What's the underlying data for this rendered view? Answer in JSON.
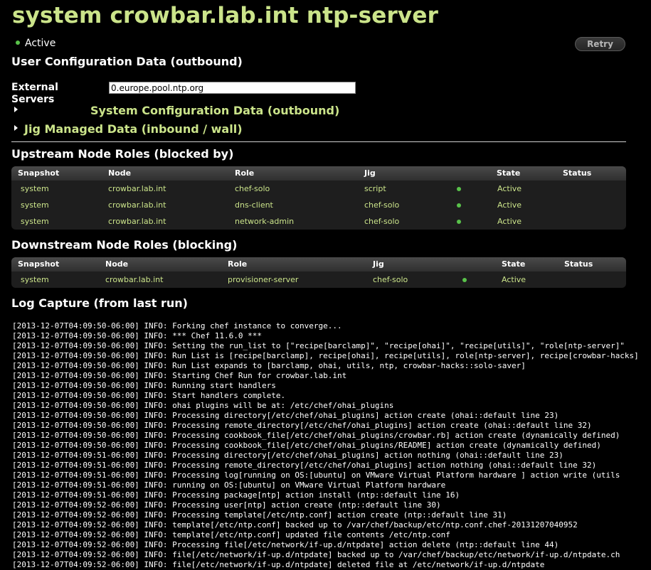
{
  "page": {
    "title": "system crowbar.lab.int ntp-server",
    "status": "Active",
    "retry_label": "Retry"
  },
  "user_config": {
    "heading": "User Configuration Data (outbound)",
    "external_servers_label": "External Servers",
    "external_servers_value": "0.europe.pool.ntp.org"
  },
  "system_config": {
    "heading": "System Configuration Data (outbound)"
  },
  "jig_data": {
    "heading": "Jig Managed Data (inbound / wall)"
  },
  "upstream": {
    "heading": "Upstream Node Roles (blocked by)",
    "columns": [
      "Snapshot",
      "Node",
      "Role",
      "Jig",
      "State",
      "Status"
    ],
    "rows": [
      {
        "snapshot": "system",
        "node": "crowbar.lab.int",
        "role": "chef-solo",
        "jig": "script",
        "state": "Active",
        "status": ""
      },
      {
        "snapshot": "system",
        "node": "crowbar.lab.int",
        "role": "dns-client",
        "jig": "chef-solo",
        "state": "Active",
        "status": ""
      },
      {
        "snapshot": "system",
        "node": "crowbar.lab.int",
        "role": "network-admin",
        "jig": "chef-solo",
        "state": "Active",
        "status": ""
      }
    ]
  },
  "downstream": {
    "heading": "Downstream Node Roles (blocking)",
    "columns": [
      "Snapshot",
      "Node",
      "Role",
      "Jig",
      "State",
      "Status"
    ],
    "rows": [
      {
        "snapshot": "system",
        "node": "crowbar.lab.int",
        "role": "provisioner-server",
        "jig": "chef-solo",
        "state": "Active",
        "status": ""
      }
    ]
  },
  "log": {
    "heading": "Log Capture (from last run)",
    "lines": [
      "[2013-12-07T04:09:50-06:00] INFO: Forking chef instance to converge...",
      "[2013-12-07T04:09:50-06:00] INFO: *** Chef 11.6.0 ***",
      "[2013-12-07T04:09:50-06:00] INFO: Setting the run_list to [\"recipe[barclamp]\", \"recipe[ohai]\", \"recipe[utils]\", \"role[ntp-server]\"",
      "[2013-12-07T04:09:50-06:00] INFO: Run List is [recipe[barclamp], recipe[ohai], recipe[utils], role[ntp-server], recipe[crowbar-hacks]",
      "[2013-12-07T04:09:50-06:00] INFO: Run List expands to [barclamp, ohai, utils, ntp, crowbar-hacks::solo-saver]",
      "[2013-12-07T04:09:50-06:00] INFO: Starting Chef Run for crowbar.lab.int",
      "[2013-12-07T04:09:50-06:00] INFO: Running start handlers",
      "[2013-12-07T04:09:50-06:00] INFO: Start handlers complete.",
      "[2013-12-07T04:09:50-06:00] INFO: ohai plugins will be at: /etc/chef/ohai_plugins",
      "[2013-12-07T04:09:50-06:00] INFO: Processing directory[/etc/chef/ohai_plugins] action create (ohai::default line 23)",
      "[2013-12-07T04:09:50-06:00] INFO: Processing remote_directory[/etc/chef/ohai_plugins] action create (ohai::default line 32)",
      "[2013-12-07T04:09:50-06:00] INFO: Processing cookbook_file[/etc/chef/ohai_plugins/crowbar.rb] action create (dynamically defined)",
      "[2013-12-07T04:09:50-06:00] INFO: Processing cookbook_file[/etc/chef/ohai_plugins/README] action create (dynamically defined)",
      "[2013-12-07T04:09:51-06:00] INFO: Processing directory[/etc/chef/ohai_plugins] action nothing (ohai::default line 23)",
      "[2013-12-07T04:09:51-06:00] INFO: Processing remote_directory[/etc/chef/ohai_plugins] action nothing (ohai::default line 32)",
      "[2013-12-07T04:09:51-06:00] INFO: Processing log[running on OS:[ubuntu] on VMware Virtual Platform hardware ] action write (utils",
      "[2013-12-07T04:09:51-06:00] INFO: running on OS:[ubuntu] on VMware Virtual Platform hardware",
      "[2013-12-07T04:09:51-06:00] INFO: Processing package[ntp] action install (ntp::default line 16)",
      "[2013-12-07T04:09:52-06:00] INFO: Processing user[ntp] action create (ntp::default line 30)",
      "[2013-12-07T04:09:52-06:00] INFO: Processing template[/etc/ntp.conf] action create (ntp::default line 31)",
      "[2013-12-07T04:09:52-06:00] INFO: template[/etc/ntp.conf] backed up to /var/chef/backup/etc/ntp.conf.chef-20131207040952",
      "[2013-12-07T04:09:52-06:00] INFO: template[/etc/ntp.conf] updated file contents /etc/ntp.conf",
      "[2013-12-07T04:09:52-06:00] INFO: Processing file[/etc/network/if-up.d/ntpdate] action delete (ntp::default line 44)",
      "[2013-12-07T04:09:52-06:00] INFO: file[/etc/network/if-up.d/ntpdate] backed up to /var/chef/backup/etc/network/if-up.d/ntpdate.ch",
      "[2013-12-07T04:09:52-06:00] INFO: file[/etc/network/if-up.d/ntpdate] deleted file at /etc/network/if-up.d/ntpdate"
    ]
  },
  "colors": {
    "accent": "#cbe48a",
    "status_ok": "#59c24a",
    "background": "#000000"
  }
}
